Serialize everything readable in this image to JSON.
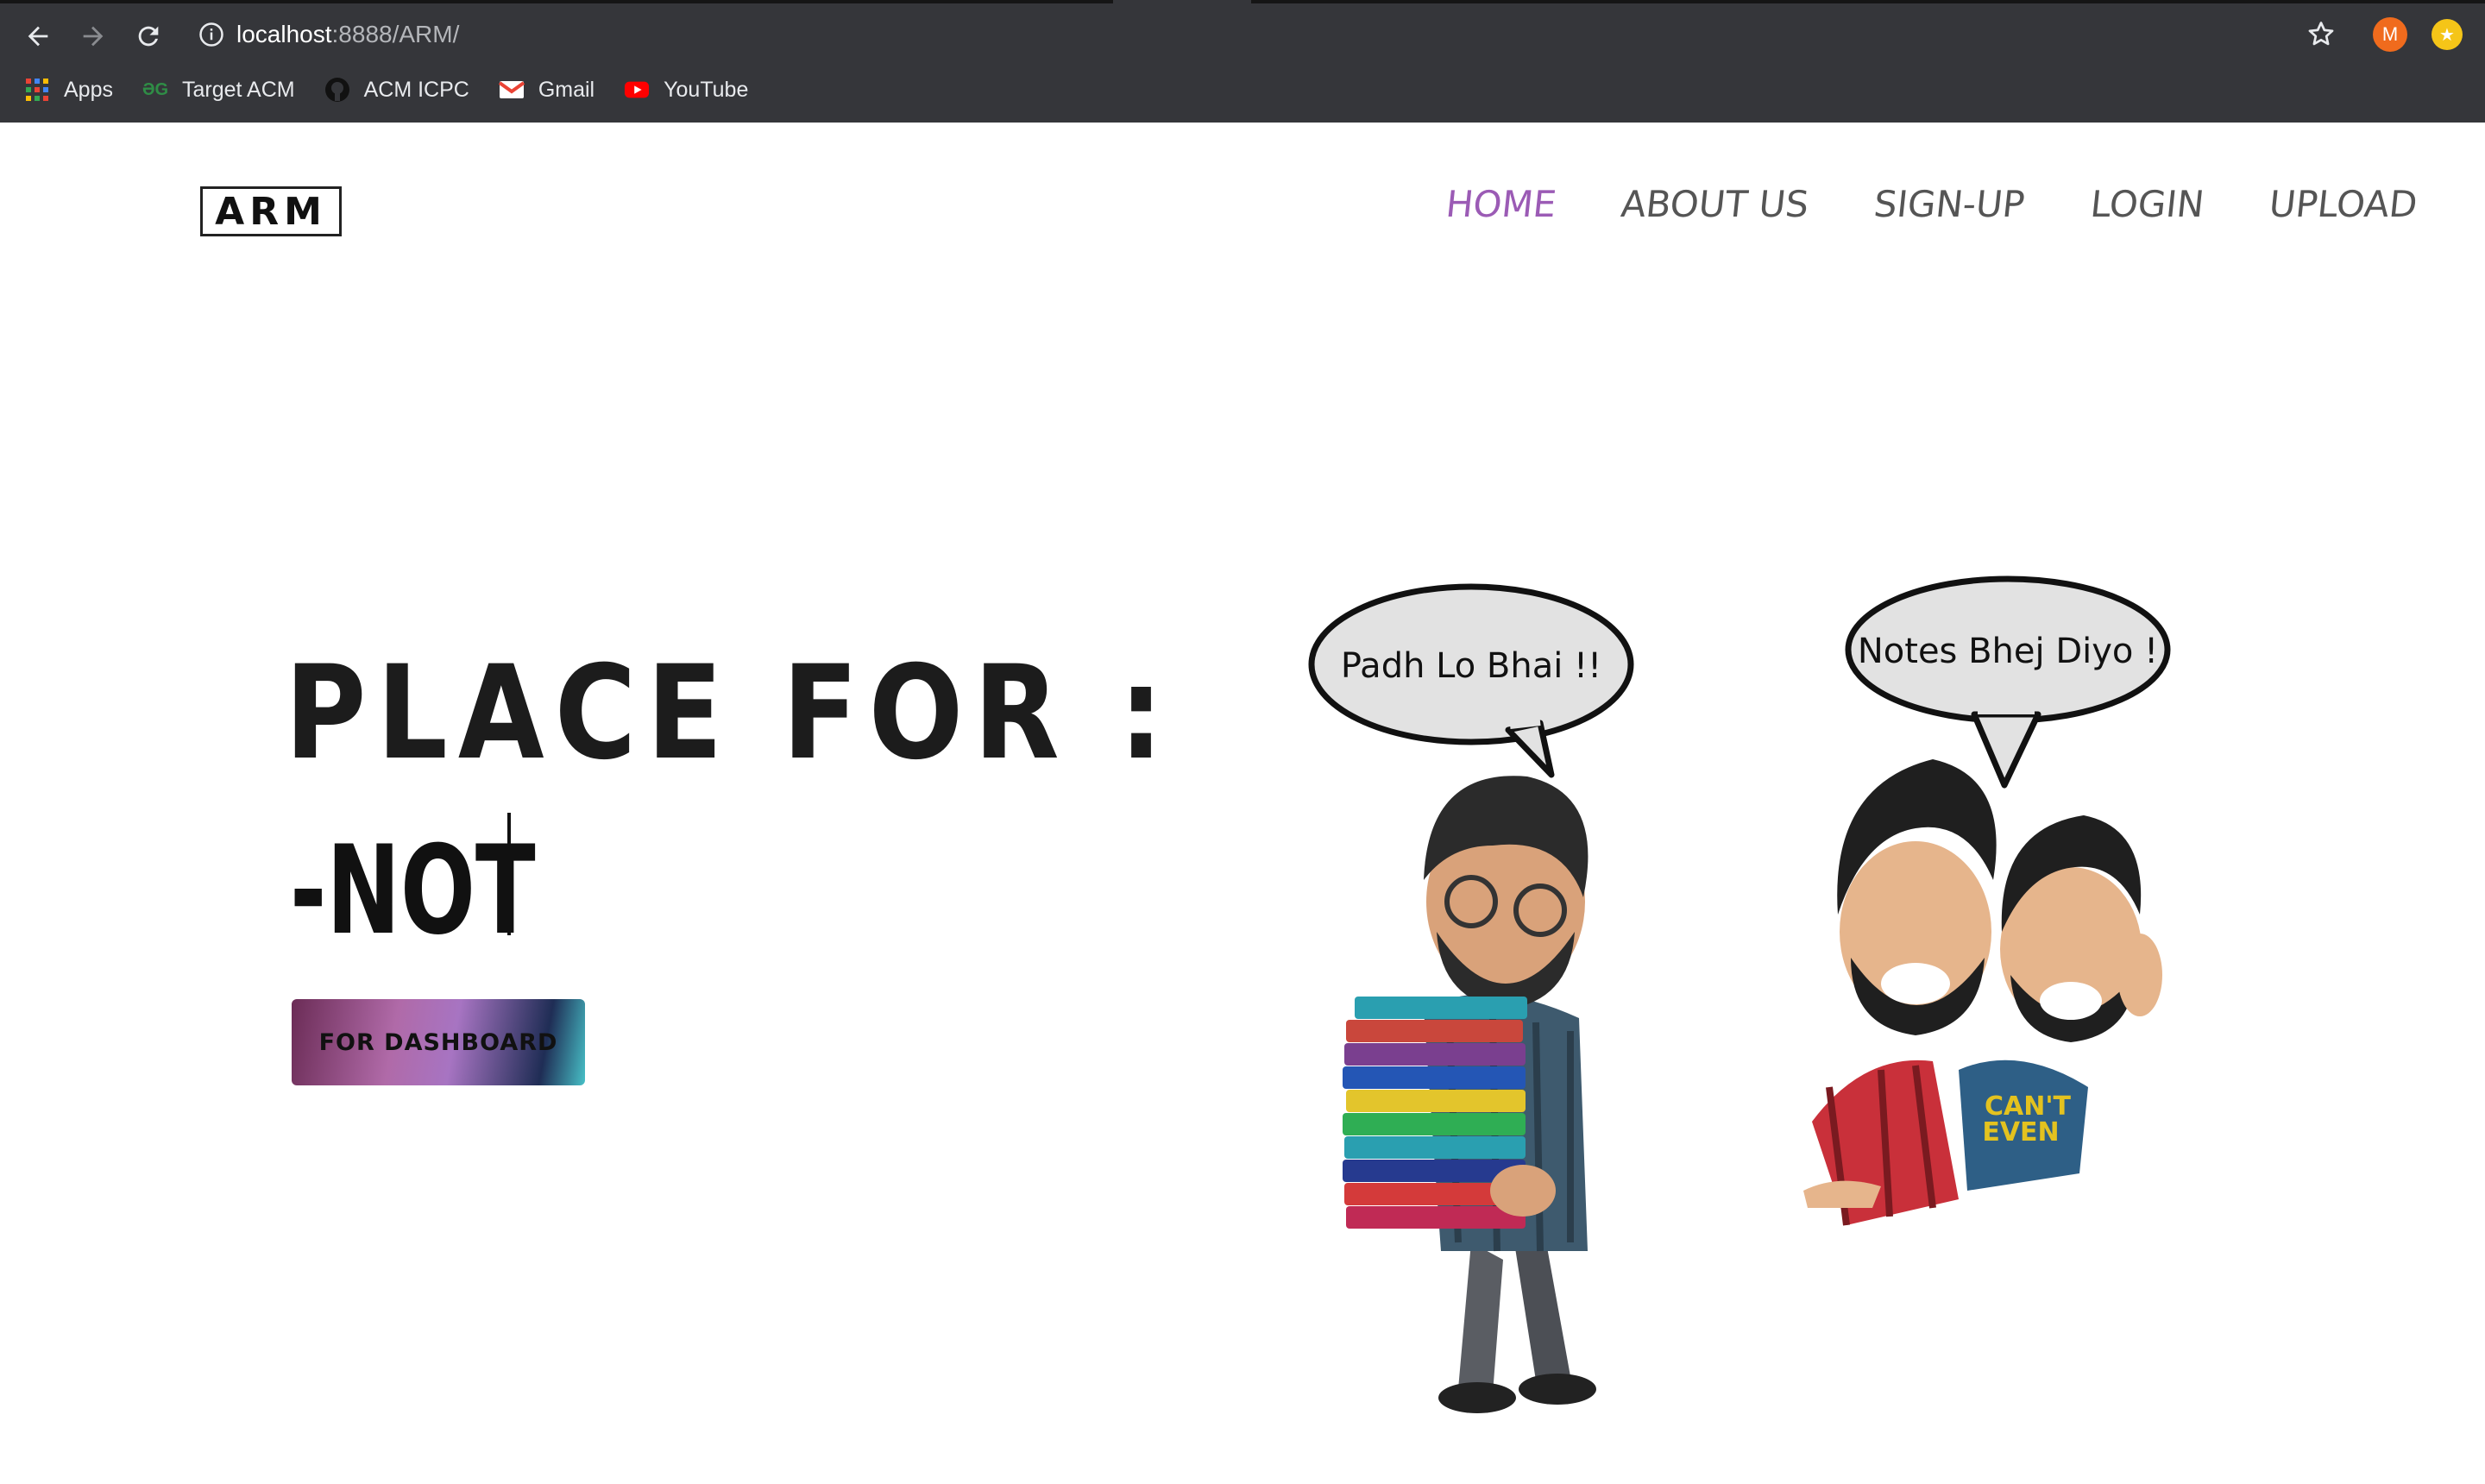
{
  "browser": {
    "url_host": "localhost",
    "url_path": ":8888/ARM/",
    "profile_initial": "M",
    "bookmarks": [
      {
        "label": "Apps",
        "icon": "apps-grid-icon"
      },
      {
        "label": "Target ACM",
        "icon": "geeksforgeeks-icon"
      },
      {
        "label": "ACM ICPC",
        "icon": "github-icon"
      },
      {
        "label": "Gmail",
        "icon": "gmail-icon"
      },
      {
        "label": "YouTube",
        "icon": "youtube-icon"
      }
    ]
  },
  "site": {
    "logo": "ARM",
    "nav": [
      {
        "label": "HOME",
        "active": true
      },
      {
        "label": "ABOUT US",
        "active": false
      },
      {
        "label": "SIGN-UP",
        "active": false
      },
      {
        "label": "LOGIN",
        "active": false
      },
      {
        "label": "UPLOAD",
        "active": false
      }
    ],
    "headline": "PLACE FOR :",
    "typed_text": "-NOT",
    "dashboard_button": "FOR DASHBOARD",
    "speech_bubbles": [
      "Padh Lo Bhai !!",
      "Notes Bhej Diyo !"
    ],
    "shirt_text": [
      "CAN'T",
      "EVEN"
    ]
  },
  "colors": {
    "chrome_bg": "#35363a",
    "nav_active": "#9b5bb5",
    "nav_inactive": "#555555"
  }
}
